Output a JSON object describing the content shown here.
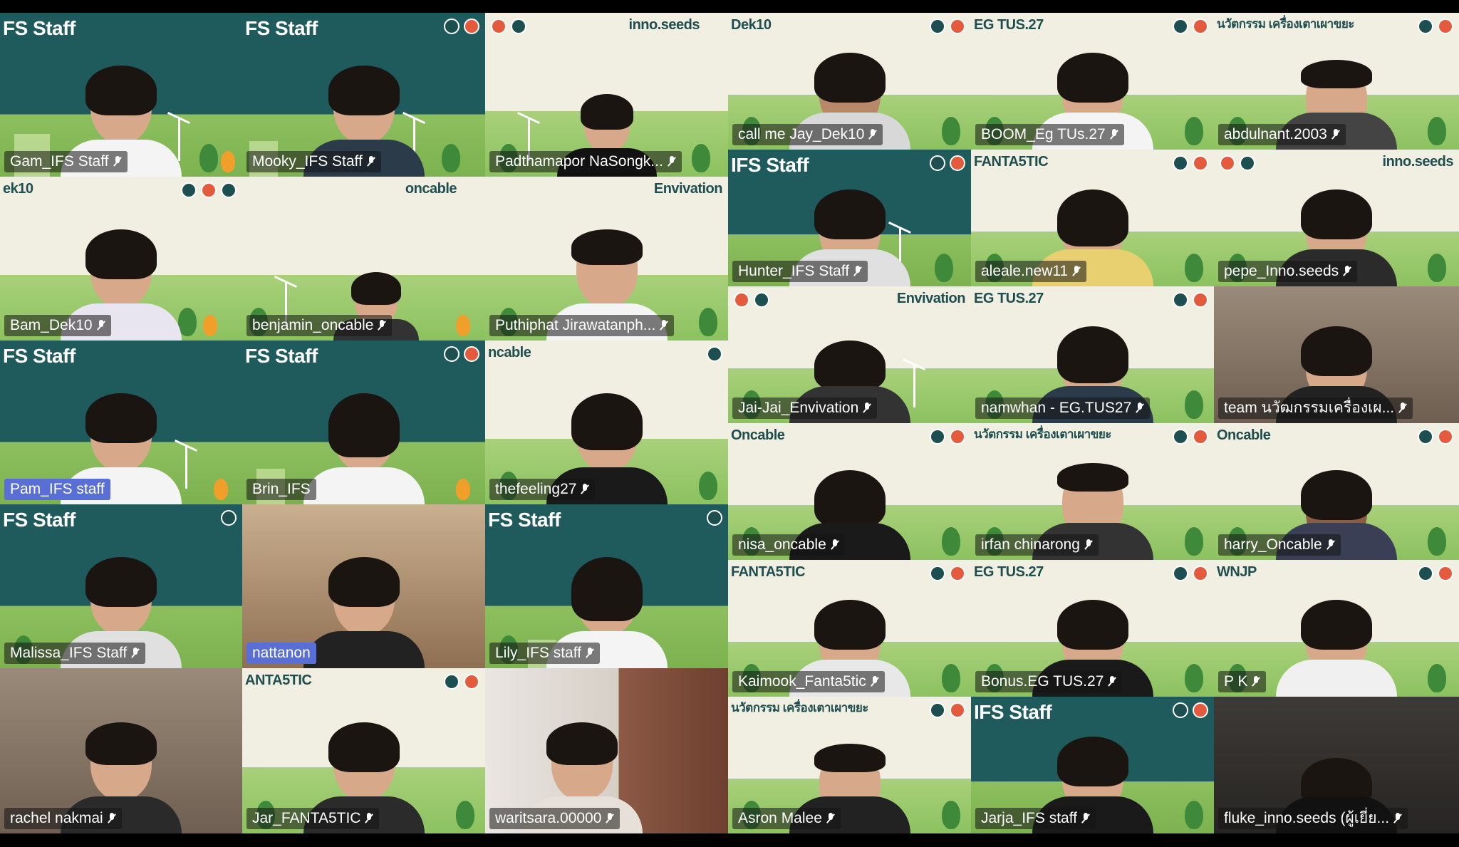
{
  "meeting": {
    "tiles": [
      {
        "name": "Gam_IFS Staff",
        "banner": "FS Staff",
        "theme": "teal",
        "muted": true
      },
      {
        "name": "Mooky_IFS Staff",
        "banner": "FS Staff",
        "theme": "teal",
        "muted": true
      },
      {
        "name": "Padthamapor NaSongk...",
        "banner": "inno.seeds",
        "theme": "cream",
        "muted": true
      },
      {
        "name": "Bam_Dek10",
        "banner": "ek10",
        "theme": "cream",
        "muted": true
      },
      {
        "name": "benjamin_oncable",
        "banner": "oncable",
        "theme": "cream",
        "muted": true
      },
      {
        "name": "Puthiphat Jirawatanph...",
        "banner": "Envivation",
        "theme": "cream",
        "muted": true
      },
      {
        "name": "Pam_IFS staff",
        "banner": "FS Staff",
        "theme": "teal",
        "muted": false,
        "highlight": true
      },
      {
        "name": "Brin_IFS",
        "banner": "FS Staff",
        "theme": "teal",
        "muted": false
      },
      {
        "name": "thefeeling27",
        "banner": "ncable",
        "theme": "cream",
        "muted": true
      },
      {
        "name": "Malissa_IFS Staff",
        "banner": "FS Staff",
        "theme": "teal",
        "muted": true
      },
      {
        "name": "nattanon",
        "banner": "",
        "theme": "wood",
        "muted": false,
        "highlight": true
      },
      {
        "name": "Lily_IFS staff",
        "banner": "FS Staff",
        "theme": "teal",
        "muted": true
      },
      {
        "name": "rachel nakmai",
        "banner": "",
        "theme": "room",
        "muted": true
      },
      {
        "name": "Jar_FANTA5TIC",
        "banner": "ANTA5TIC",
        "theme": "cream",
        "muted": true
      },
      {
        "name": "waritsara.00000",
        "banner": "",
        "theme": "curtain",
        "muted": true
      },
      {
        "name": "call me Jay_Dek10",
        "banner": "Dek10",
        "theme": "cream",
        "muted": true
      },
      {
        "name": "BOOM_Eg TUs.27",
        "banner": "EG TUS.27",
        "theme": "cream",
        "muted": true
      },
      {
        "name": "abdulnant.2003",
        "banner": "นวัตกรรม เครื่องเตาเผาขยะ",
        "theme": "cream",
        "muted": true
      },
      {
        "name": "Hunter_IFS Staff",
        "banner": "IFS Staff",
        "theme": "teal",
        "muted": true
      },
      {
        "name": "aleale.new11",
        "banner": "FANTA5TIC",
        "theme": "cream",
        "muted": true
      },
      {
        "name": "pepe_Inno.seeds",
        "banner": "inno.seeds",
        "theme": "cream",
        "muted": true
      },
      {
        "name": "Jai-Jai_Envivation",
        "banner": "Envivation",
        "theme": "cream",
        "muted": true
      },
      {
        "name": "namwhan - EG.TUS27",
        "banner": "EG TUS.27",
        "theme": "cream",
        "muted": true
      },
      {
        "name": "team นวัฒกรรมเครื่องเผ...",
        "banner": "",
        "theme": "room",
        "muted": true
      },
      {
        "name": "nisa_oncable",
        "banner": "Oncable",
        "theme": "cream",
        "muted": true
      },
      {
        "name": "irfan chinarong",
        "banner": "นวัตกรรม เครื่องเตาเผาขยะ",
        "theme": "cream",
        "muted": true
      },
      {
        "name": "harry_Oncable",
        "banner": "Oncable",
        "theme": "cream",
        "muted": true
      },
      {
        "name": "Kaimook_Fanta5tic",
        "banner": "FANTA5TIC",
        "theme": "cream",
        "muted": true
      },
      {
        "name": "Bonus.EG TUS.27",
        "banner": "EG TUS.27",
        "theme": "cream",
        "muted": true
      },
      {
        "name": "P K",
        "banner": "WNJP",
        "theme": "cream",
        "muted": true
      },
      {
        "name": "Asron Malee",
        "banner": "นวัตกรรม เครื่องเตาเผาขยะ",
        "theme": "cream",
        "muted": true
      },
      {
        "name": "Jarja_IFS staff",
        "banner": "IFS Staff",
        "theme": "teal",
        "muted": true
      },
      {
        "name": "fluke_inno.seeds (ผู้เยี่ย...",
        "banner": "",
        "theme": "dark",
        "muted": true
      }
    ]
  }
}
